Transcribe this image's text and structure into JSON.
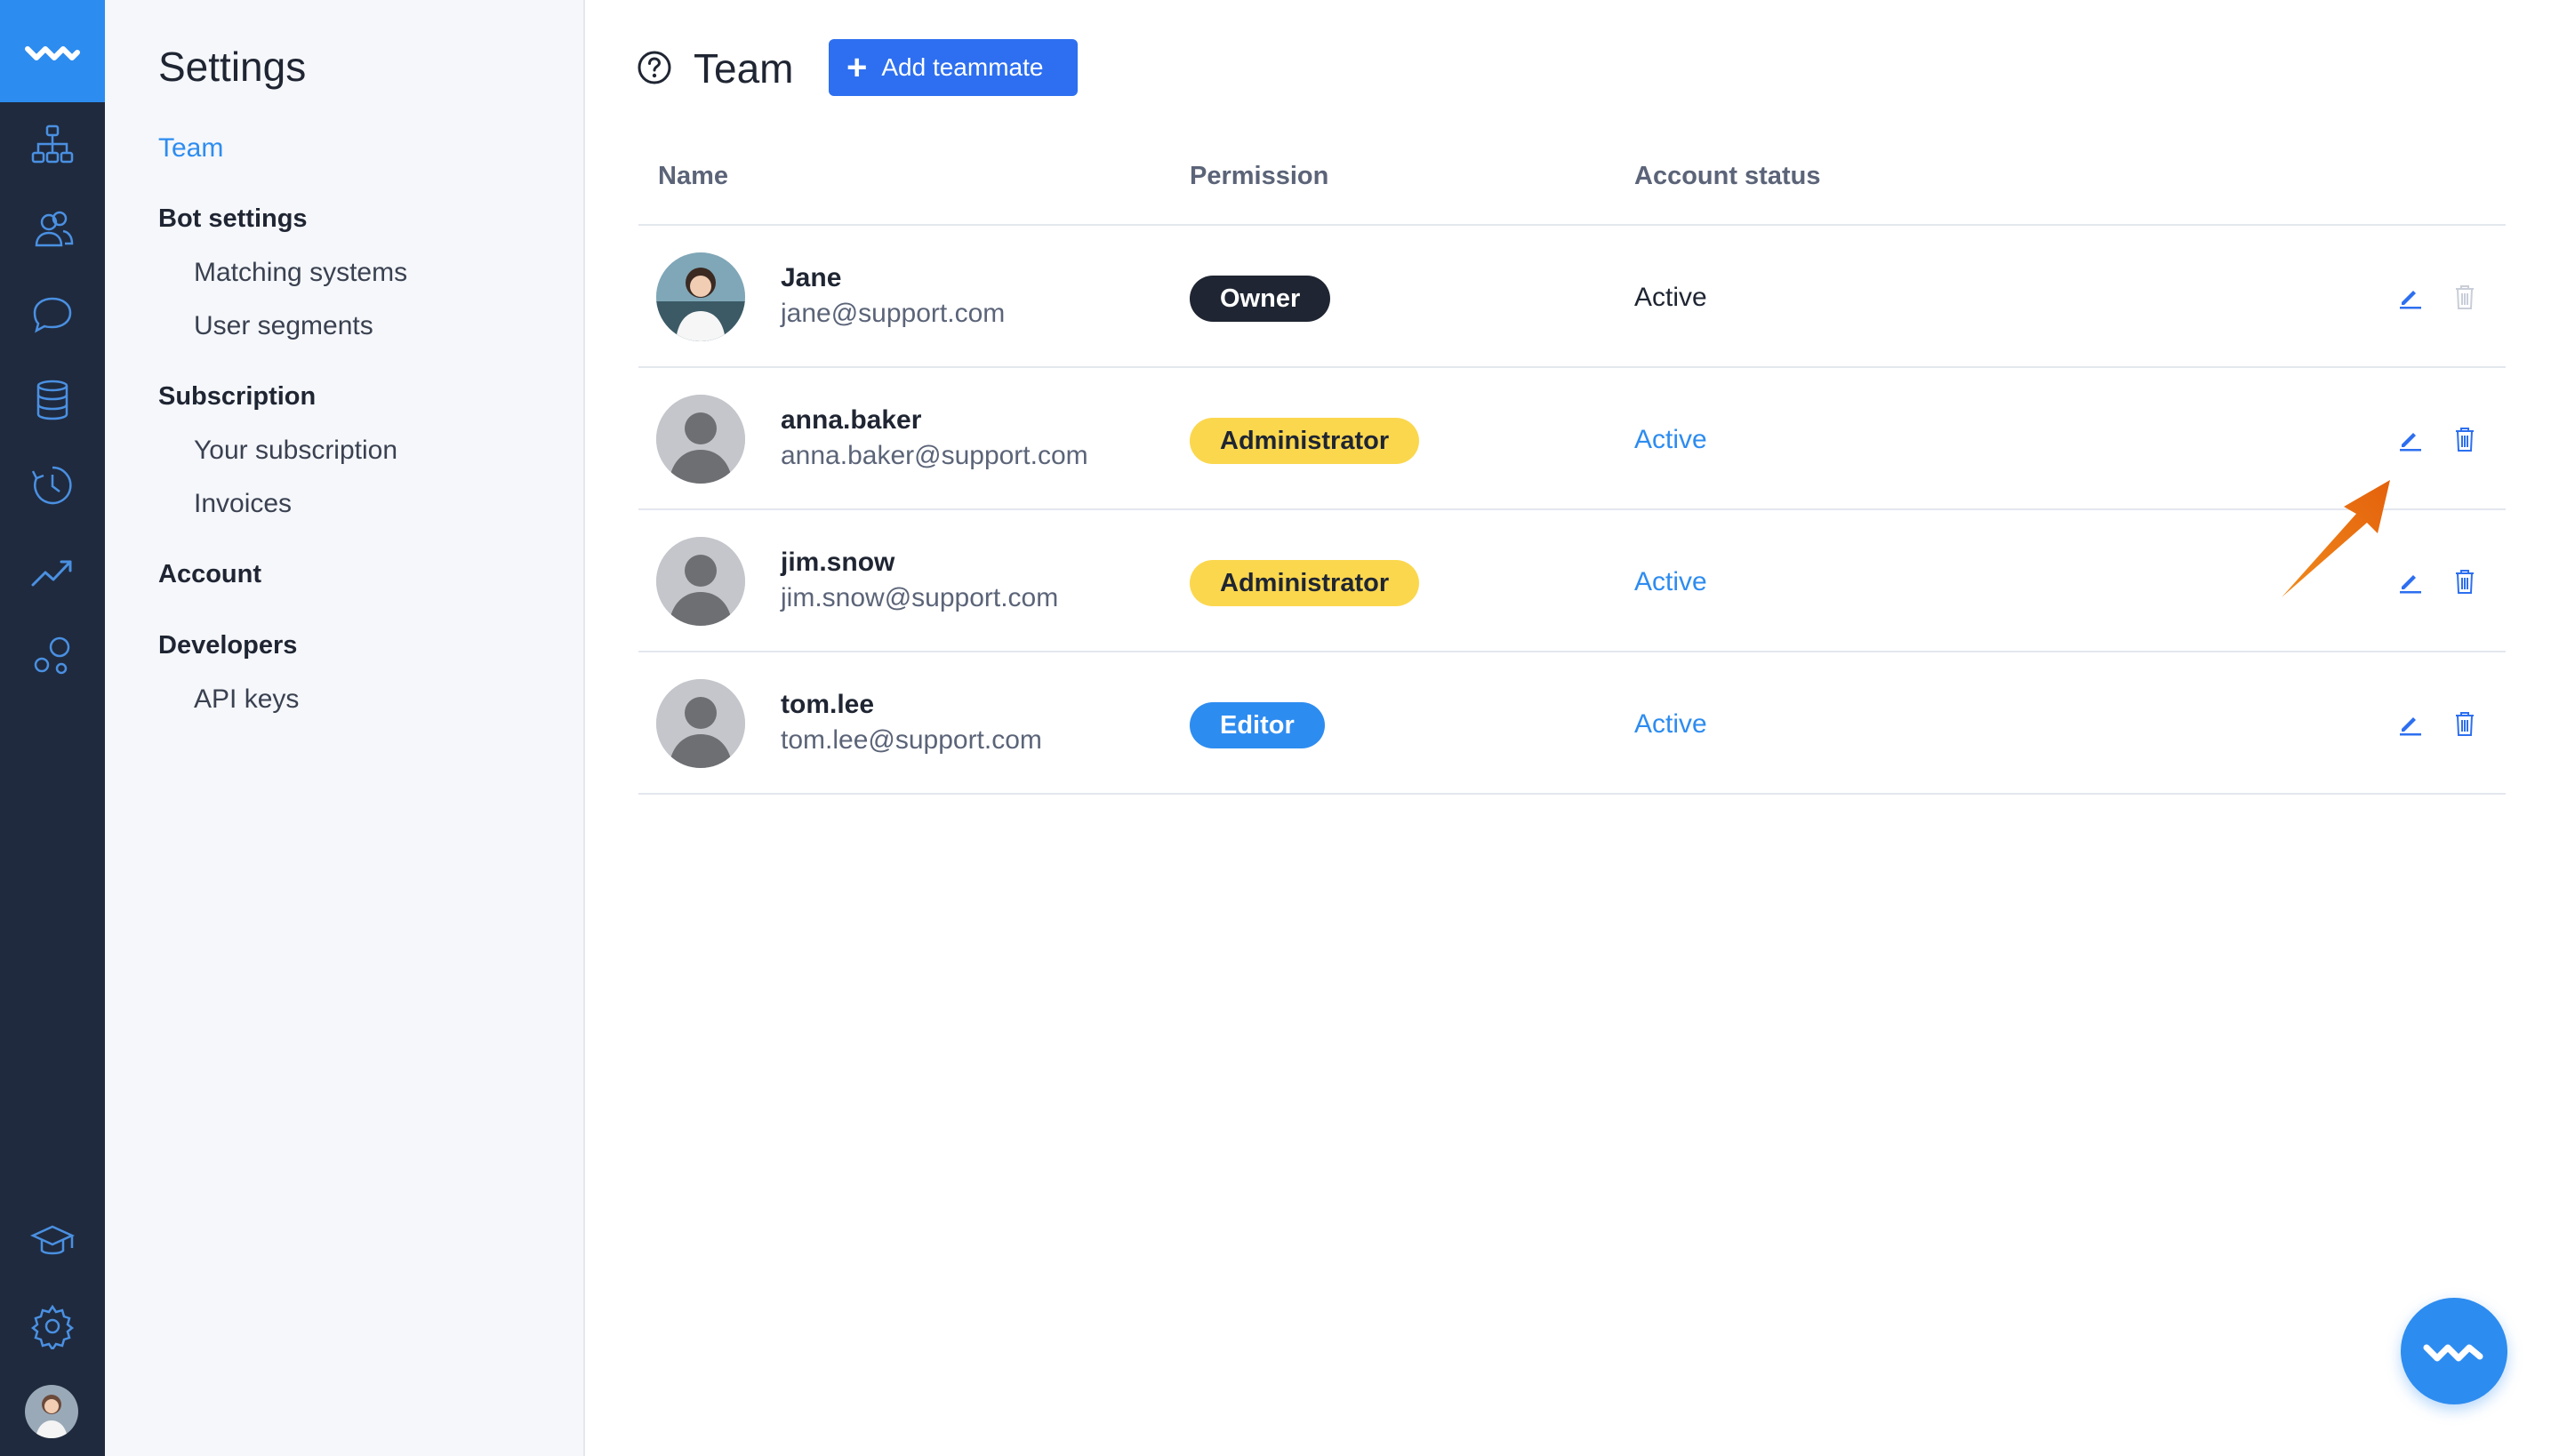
{
  "rail": {
    "icons": [
      "logo-wave-icon",
      "org-chart-icon",
      "users-icon",
      "chat-bubble-icon",
      "database-icon",
      "history-clock-icon",
      "trend-chart-icon",
      "bubbles-icon",
      "graduation-cap-icon",
      "gear-icon",
      "user-avatar"
    ]
  },
  "settings": {
    "title": "Settings",
    "team": "Team",
    "bot_settings": "Bot settings",
    "matching_systems": "Matching systems",
    "user_segments": "User segments",
    "subscription": "Subscription",
    "your_subscription": "Your subscription",
    "invoices": "Invoices",
    "account": "Account",
    "developers": "Developers",
    "api_keys": "API keys"
  },
  "main": {
    "title": "Team",
    "add_button": "Add teammate",
    "columns": {
      "name": "Name",
      "permission": "Permission",
      "status": "Account status"
    },
    "rows": [
      {
        "name": "Jane",
        "email": "jane@support.com",
        "permission": "Owner",
        "status": "Active"
      },
      {
        "name": "anna.baker",
        "email": "anna.baker@support.com",
        "permission": "Administrator",
        "status": "Active"
      },
      {
        "name": "jim.snow",
        "email": "jim.snow@support.com",
        "permission": "Administrator",
        "status": "Active"
      },
      {
        "name": "tom.lee",
        "email": "tom.lee@support.com",
        "permission": "Editor",
        "status": "Active"
      }
    ]
  },
  "colors": {
    "rail_bg": "#1f2a3e",
    "accent": "#2d8cf0",
    "button": "#2d6ff0",
    "owner_badge": "#1f2532",
    "admin_badge": "#fbd74e",
    "editor_badge": "#2d8cf0",
    "annotation_arrow": "#f07a1a"
  }
}
